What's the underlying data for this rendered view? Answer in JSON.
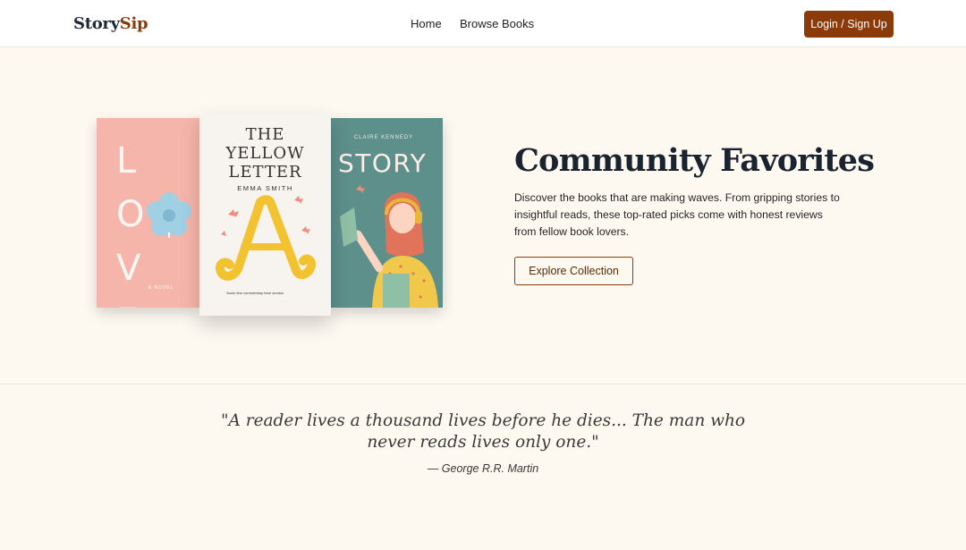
{
  "header": {
    "logo_part1": "Story",
    "logo_part2": "Sip",
    "nav": [
      {
        "label": "Home"
      },
      {
        "label": "Browse Books"
      }
    ],
    "login_label": "Login / Sign Up"
  },
  "books": {
    "love": {
      "letters": "L O V E Y",
      "small_text": "A NOVEL"
    },
    "yellow": {
      "title_line1": "THE",
      "title_line2": "YELLOW",
      "title_line3": "LETTER",
      "author": "EMMA SMITH",
      "bottom_text": "Some fine commentary here section"
    },
    "story": {
      "author": "CLAIRE KENNEDY",
      "title": "STORY"
    }
  },
  "hero": {
    "title": "Community Favorites",
    "description": "Discover the books that are making waves. From gripping stories to insightful reads, these top-rated picks come with honest reviews from fellow book lovers.",
    "button_label": "Explore Collection"
  },
  "quote": {
    "text": "\"A reader lives a thousand lives before he dies... The man who never reads lives only one.\"",
    "author": "— George R.R. Martin"
  },
  "colors": {
    "brand": "#8b3a0a",
    "background": "#fdf8f0",
    "heading": "#1a2330"
  }
}
